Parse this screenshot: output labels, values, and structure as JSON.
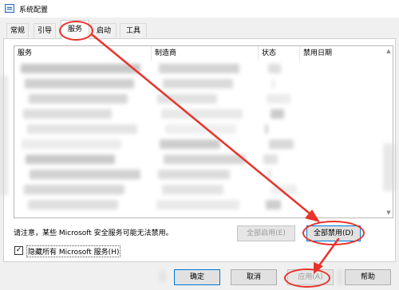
{
  "window": {
    "title": "系统配置"
  },
  "tabs": [
    "常规",
    "引导",
    "服务",
    "启动",
    "工具"
  ],
  "services_table": {
    "columns": [
      "服务",
      "制造商",
      "状态",
      "禁用日期"
    ]
  },
  "note": "请注意，某些 Microsoft 安全服务可能无法禁用。",
  "buttons": {
    "enable_all": "全部启用(E)",
    "disable_all": "全部禁用(D)",
    "ok": "确定",
    "cancel": "取消",
    "apply": "应用(A)",
    "help": "帮助"
  },
  "hide_microsoft": {
    "label": "隐藏所有 Microsoft 服务(H)",
    "checked": true
  },
  "colors": {
    "annotation": "#e8332a",
    "accent": "#0078d7"
  },
  "icons": {
    "app": "system-config-icon",
    "check": "checkmark-icon"
  }
}
